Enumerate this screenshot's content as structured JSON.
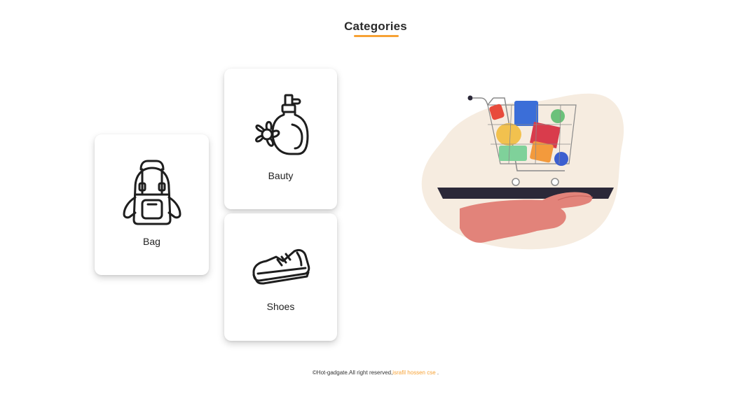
{
  "section": {
    "title": "Categories"
  },
  "categories": [
    {
      "label": "Bag",
      "icon": "backpack-icon"
    },
    {
      "label": "Bauty",
      "icon": "perfume-flower-icon"
    },
    {
      "label": "Shoes",
      "icon": "sneaker-icon"
    }
  ],
  "illustration": {
    "icon": "hand-holding-shopping-cart-illustration"
  },
  "footer": {
    "copyright": "©Hot-gadgate.All right reserved,",
    "author": "israfil hossen cse",
    "suffix": " ."
  },
  "colors": {
    "accent": "#f7a235",
    "text": "#222222",
    "blob": "#f6ece0",
    "hand": "#e2837a",
    "tray": "#2b2838"
  }
}
